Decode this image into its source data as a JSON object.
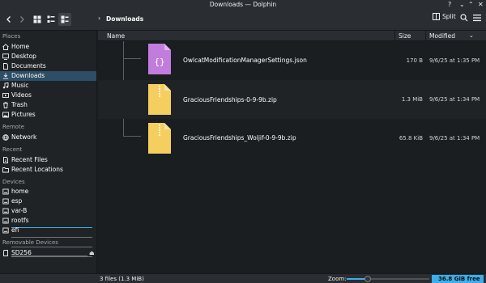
{
  "window": {
    "title": "Downloads — Dolphin",
    "controls": {
      "help": "?",
      "minimize": "⌄",
      "maximize": "⌃",
      "close": "✕"
    }
  },
  "toolbar": {
    "back_icon": "chevron-left-icon",
    "forward_icon": "chevron-right-icon",
    "breadcrumb_arrow": "›",
    "breadcrumb": "Downloads",
    "split_label": "Split",
    "view_modes": [
      "icons-view",
      "compact-view",
      "details-view"
    ],
    "active_view": "details-view"
  },
  "sidebar": {
    "places": {
      "title": "Places",
      "items": [
        {
          "label": "Home",
          "icon": "home-icon"
        },
        {
          "label": "Desktop",
          "icon": "desktop-icon"
        },
        {
          "label": "Documents",
          "icon": "documents-icon"
        },
        {
          "label": "Downloads",
          "icon": "downloads-icon",
          "selected": true
        },
        {
          "label": "Music",
          "icon": "music-icon"
        },
        {
          "label": "Videos",
          "icon": "videos-icon"
        },
        {
          "label": "Trash",
          "icon": "trash-icon"
        },
        {
          "label": "Pictures",
          "icon": "pictures-icon"
        }
      ]
    },
    "remote": {
      "title": "Remote",
      "items": [
        {
          "label": "Network",
          "icon": "network-icon"
        }
      ]
    },
    "recent": {
      "title": "Recent",
      "items": [
        {
          "label": "Recent Files",
          "icon": "recent-files-icon"
        },
        {
          "label": "Recent Locations",
          "icon": "recent-locations-icon"
        }
      ]
    },
    "devices": {
      "title": "Devices",
      "items": [
        {
          "label": "home",
          "icon": "drive-icon"
        },
        {
          "label": "esp",
          "icon": "drive-icon"
        },
        {
          "label": "var-B",
          "icon": "drive-icon"
        },
        {
          "label": "rootfs",
          "icon": "drive-icon"
        },
        {
          "label": "efi",
          "icon": "drive-icon"
        }
      ]
    },
    "removable": {
      "title": "Removable Devices",
      "items": [
        {
          "label": "SD256",
          "icon": "sdcard-icon",
          "eject": "⏏"
        }
      ]
    }
  },
  "columns": {
    "name": "Name",
    "size": "Size",
    "modified": "Modified"
  },
  "files": [
    {
      "name": "OwlcatModificationManagerSettings.json",
      "size": "170 B",
      "modified": "9/6/25 at 1:35 PM",
      "type": "json"
    },
    {
      "name": "GraciousFriendships-0-9-9b.zip",
      "size": "1.3 MiB",
      "modified": "9/6/25 at 1:34 PM",
      "type": "zip"
    },
    {
      "name": "GraciousFriendships_Woljif-0-9-9b.zip",
      "size": "65.8 KiB",
      "modified": "9/6/25 at 1:34 PM",
      "type": "zip"
    }
  ],
  "status": {
    "summary": "3 files (1.3 MiB)",
    "zoom_label": "Zoom:",
    "zoom_level": 0.2,
    "free_space": "36.8 GiB free"
  },
  "colors": {
    "accent": "#3daee9",
    "selection": "#2c4e67",
    "json_icon": "#c17ddc",
    "zip_icon": "#f4cf5f"
  }
}
